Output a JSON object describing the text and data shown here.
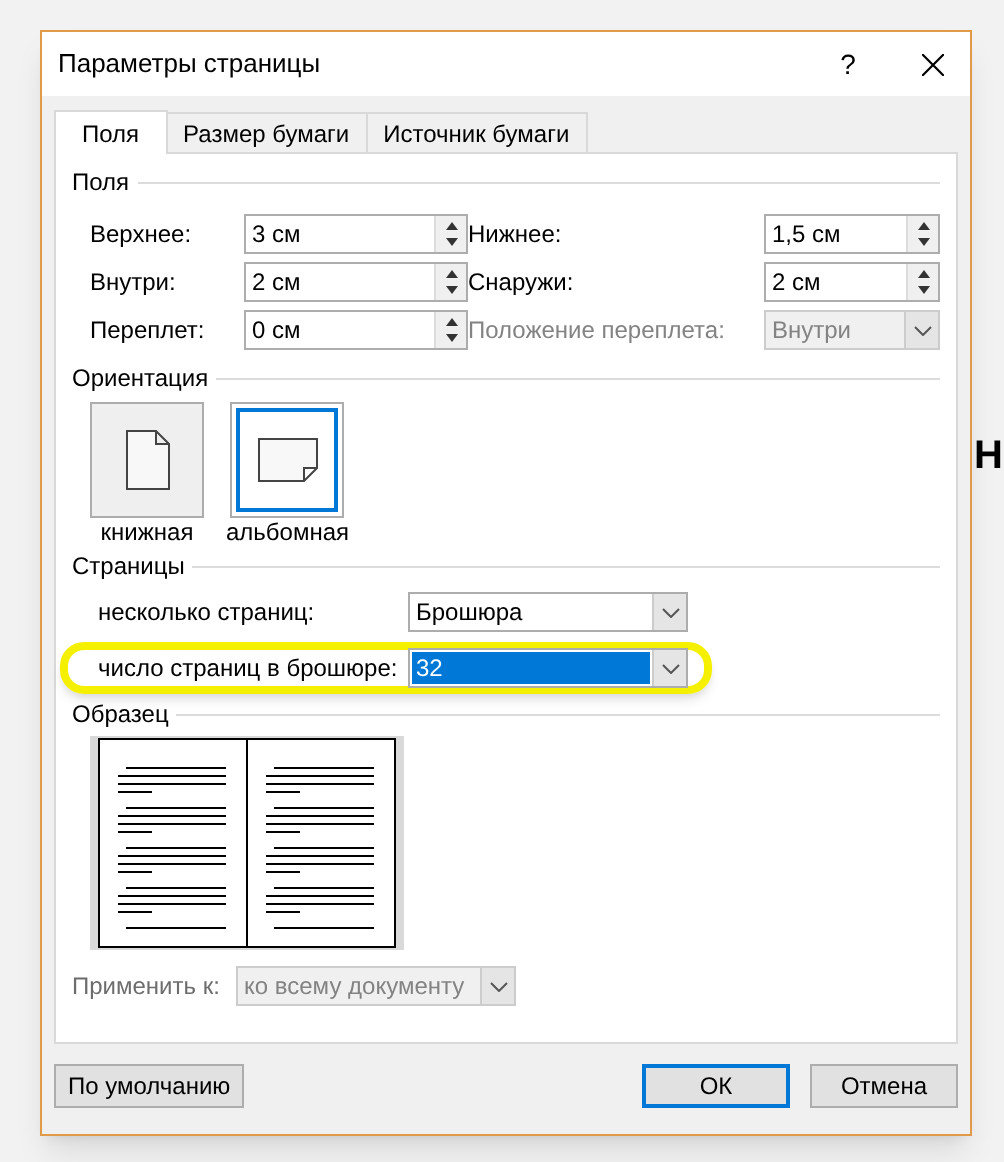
{
  "background_text": "Н",
  "window": {
    "title": "Параметры страницы",
    "help": "?"
  },
  "tabs": [
    {
      "label": "Поля",
      "selected": true
    },
    {
      "label": "Размер бумаги",
      "selected": false
    },
    {
      "label": "Источник бумаги",
      "selected": false
    }
  ],
  "margins": {
    "title": "Поля",
    "fields": [
      {
        "label": "Верхнее:",
        "value": "3 см",
        "kind": "spin",
        "disabled": false
      },
      {
        "label": "Нижнее:",
        "value": "1,5 см",
        "kind": "spin",
        "disabled": false
      },
      {
        "label": "Внутри:",
        "value": "2 см",
        "kind": "spin",
        "disabled": false
      },
      {
        "label": "Снаружи:",
        "value": "2 см",
        "kind": "spin",
        "disabled": false
      },
      {
        "label": "Переплет:",
        "value": "0 см",
        "kind": "spin",
        "disabled": false
      },
      {
        "label": "Положение переплета:",
        "value": "Внутри",
        "kind": "select",
        "disabled": true
      }
    ]
  },
  "orientation": {
    "title": "Ориентация",
    "options": [
      {
        "label": "книжная",
        "kind": "portrait",
        "selected": false
      },
      {
        "label": "альбомная",
        "kind": "landscape",
        "selected": true
      }
    ]
  },
  "pages": {
    "title": "Страницы",
    "rows": [
      {
        "label": "несколько страниц:",
        "value": "Брошюра",
        "focused": false
      },
      {
        "label": "число страниц в брошюре:",
        "value": "32",
        "focused": true,
        "highlighted": true
      }
    ]
  },
  "preview": {
    "title": "Образец"
  },
  "apply_to": {
    "label": "Применить к:",
    "value": "ко всему документу",
    "disabled": true
  },
  "buttons": [
    {
      "label": "По умолчанию",
      "default": false
    },
    {
      "label": "ОК",
      "default": true
    },
    {
      "label": "Отмена",
      "default": false
    }
  ]
}
